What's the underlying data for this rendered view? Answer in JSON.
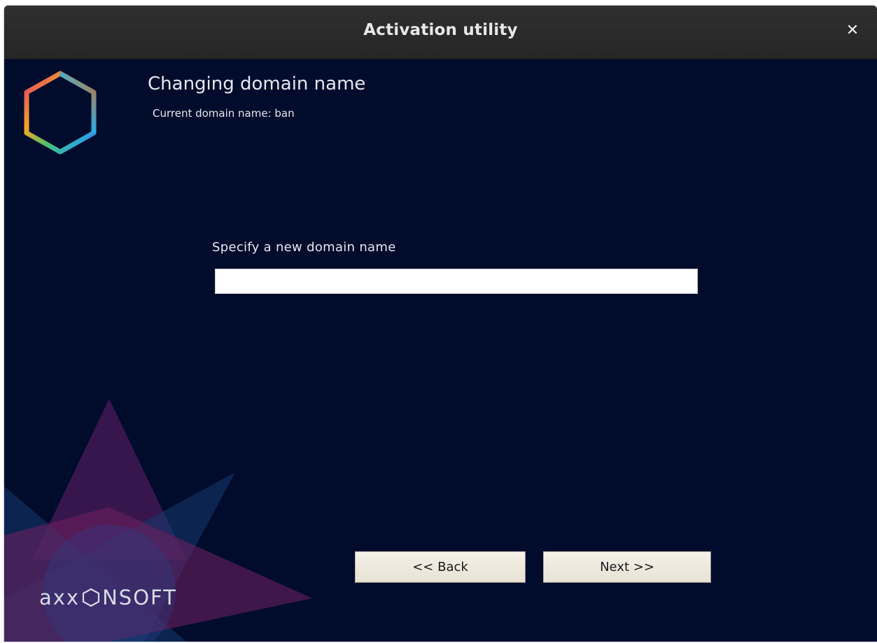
{
  "window": {
    "title": "Activation utility",
    "close_symbol": "✕"
  },
  "page": {
    "heading": "Changing domain name",
    "current_domain_label": "Current domain name: ban"
  },
  "form": {
    "label": "Specify a new domain name",
    "domain_value": "",
    "placeholder": ""
  },
  "buttons": {
    "back_label": "<< Back",
    "next_label": "Next >>"
  },
  "brand": {
    "part1": "axx",
    "part2": "nsoft"
  },
  "colors": {
    "background": "#010c2d",
    "titlebar": "#2b2b2b",
    "text": "#e6e8ee",
    "button_face": "#efebdf"
  },
  "icons": {
    "logo": "hexagon-logo-icon",
    "close": "close-icon"
  }
}
